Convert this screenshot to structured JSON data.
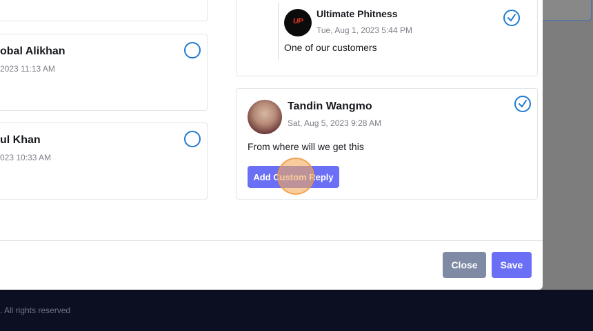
{
  "footer": {
    "copyright": ". All rights reserved"
  },
  "left_cards": [
    {
      "name": "obal Alikhan",
      "date": "2023 11:13 AM"
    },
    {
      "name": "ul Khan",
      "date": "023 10:33 AM"
    }
  ],
  "reply_card": {
    "name": "Ultimate Phitness",
    "date": "Tue, Aug 1, 2023 5:44 PM",
    "message": "One of our customers",
    "avatar_text": "UP"
  },
  "comment_card": {
    "name": "Tandin Wangmo",
    "date": "Sat, Aug 5, 2023 9:28 AM",
    "message": "From where will we get this",
    "button_label": "Add Custom Reply"
  },
  "actions": {
    "close_label": "Close",
    "save_label": "Save"
  },
  "colors": {
    "accent": "#6a6ff6",
    "check": "#1f7ad1",
    "footer_bg": "#0c0f22",
    "close_btn": "#7f8aa5"
  }
}
